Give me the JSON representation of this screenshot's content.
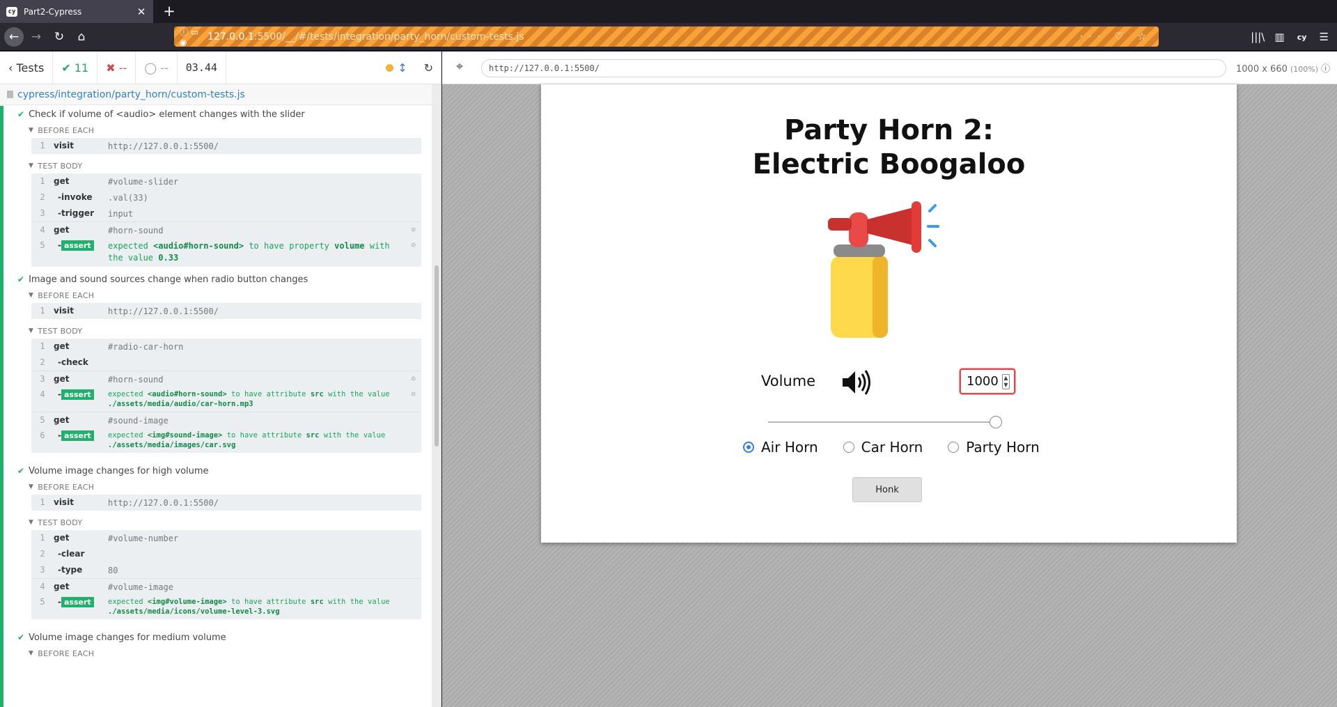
{
  "browser": {
    "tab_title": "Part2-Cypress",
    "tab_favicon": "cy",
    "url_host": "127.0.0.1",
    "url_path": ":5500/__/#/tests/integration/party_horn/custom-tests.js"
  },
  "reporter": {
    "tests_label": "Tests",
    "passed": "11",
    "failed": "--",
    "pending": "--",
    "duration": "03.44",
    "spec_path": "cypress/integration/party_horn/custom-tests.js",
    "before_each": "BEFORE EACH",
    "test_body": "TEST BODY",
    "tests": [
      {
        "title": "Check if volume of <audio> element changes with the slider",
        "before": [
          {
            "num": "1",
            "name": "visit",
            "msg": "http://127.0.0.1:5500/"
          }
        ],
        "body": [
          {
            "num": "1",
            "name": "get",
            "msg": "#volume-slider"
          },
          {
            "num": "2",
            "name": "-invoke",
            "msg": ".val(33)"
          },
          {
            "num": "3",
            "name": "-trigger",
            "msg": "input"
          },
          {
            "num": "4",
            "name": "get",
            "msg": "#horn-sound"
          },
          {
            "num": "5",
            "name": "assert",
            "msg_a": "expected",
            "msg_b": "<audio#horn-sound>",
            "msg_c": "to have property",
            "msg_d": "volume",
            "msg_e": "with the value",
            "msg_f": "0.33"
          }
        ]
      },
      {
        "title": "Image and sound sources change when radio button changes",
        "before": [
          {
            "num": "1",
            "name": "visit",
            "msg": "http://127.0.0.1:5500/"
          }
        ],
        "body": [
          {
            "num": "1",
            "name": "get",
            "msg": "#radio-car-horn"
          },
          {
            "num": "2",
            "name": "-check",
            "msg": ""
          },
          {
            "num": "3",
            "name": "get",
            "msg": "#horn-sound"
          },
          {
            "num": "4",
            "name": "assert",
            "msg_a": "expected",
            "msg_b": "<audio#horn-sound>",
            "msg_c": "to have attribute",
            "msg_d": "src",
            "msg_e": "with the value",
            "msg_f": "./assets/media/audio/car-horn.mp3"
          },
          {
            "num": "5",
            "name": "get",
            "msg": "#sound-image"
          },
          {
            "num": "6",
            "name": "assert",
            "msg_a": "expected",
            "msg_b": "<img#sound-image>",
            "msg_c": "to have attribute",
            "msg_d": "src",
            "msg_e": "with the value",
            "msg_f": "./assets/media/images/car.svg"
          }
        ]
      },
      {
        "title": "Volume image changes for high volume",
        "before": [
          {
            "num": "1",
            "name": "visit",
            "msg": "http://127.0.0.1:5500/"
          }
        ],
        "body": [
          {
            "num": "1",
            "name": "get",
            "msg": "#volume-number"
          },
          {
            "num": "2",
            "name": "-clear",
            "msg": ""
          },
          {
            "num": "3",
            "name": "-type",
            "msg": "80"
          },
          {
            "num": "4",
            "name": "get",
            "msg": "#volume-image"
          },
          {
            "num": "5",
            "name": "assert",
            "msg_a": "expected",
            "msg_b": "<img#volume-image>",
            "msg_c": "to have attribute",
            "msg_d": "src",
            "msg_e": "with the value",
            "msg_f": "./assets/media/icons/volume-level-3.svg"
          }
        ]
      },
      {
        "title": "Volume image changes for medium volume"
      }
    ]
  },
  "aut": {
    "url": "http://127.0.0.1:5500/",
    "viewport": "1000 x 660",
    "scale": "(100%)",
    "title_line1": "Party Horn 2:",
    "title_line2": "Electric Boogaloo",
    "volume_label": "Volume",
    "volume_value": "1000",
    "slider_fraction": 1.0,
    "radios": [
      {
        "label": "Air Horn",
        "checked": true
      },
      {
        "label": "Car Horn",
        "checked": false
      },
      {
        "label": "Party Horn",
        "checked": false
      }
    ],
    "honk_label": "Honk",
    "colors": {
      "pass": "#1fb06b",
      "fail": "#d14c4c",
      "accent": "#2f7fe0"
    }
  }
}
